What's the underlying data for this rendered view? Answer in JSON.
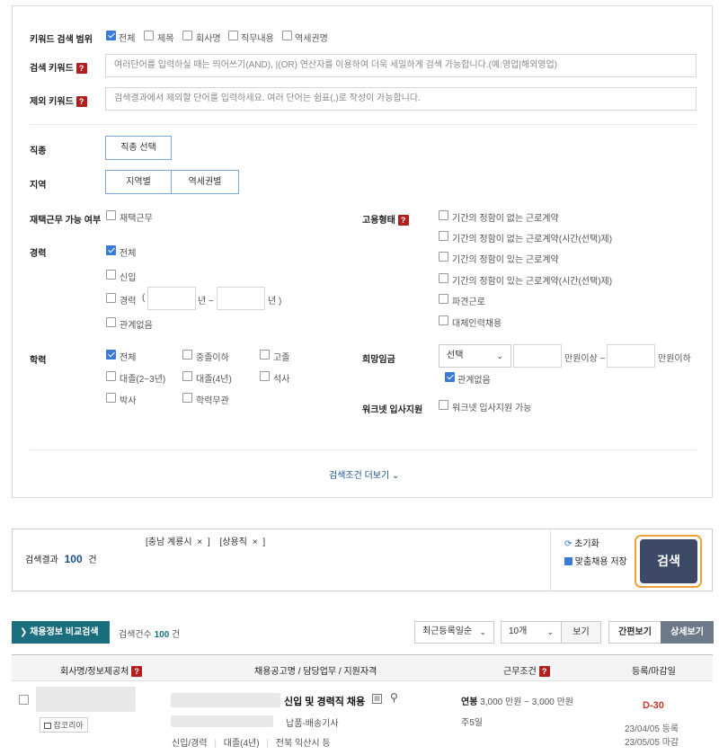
{
  "search_panel": {
    "keyword_scope_label": "키워드 검색 범위",
    "scope_options": [
      {
        "label": "전체",
        "checked": true
      },
      {
        "label": "제목",
        "checked": false
      },
      {
        "label": "회사명",
        "checked": false
      },
      {
        "label": "직무내용",
        "checked": false
      },
      {
        "label": "역세권명",
        "checked": false
      }
    ],
    "search_keyword_label": "검색 키워드",
    "search_keyword_placeholder": "여러단어를 입력하실 때는 띄어쓰기(AND), |(OR) 연산자를 이용하여 더욱 세밀하게 검색 가능합니다.(예:영업|해외영업)",
    "exclude_keyword_label": "제외 키워드",
    "exclude_keyword_placeholder": "검색결과에서 제외할 단어를 입력하세요. 여러 단어는 쉼표(,)로 작성이 가능합니다.",
    "job_type_label": "직종",
    "job_type_button": "직종 선택",
    "region_label": "지역",
    "region_button": "지역별",
    "station_button": "역세권별",
    "remote_label": "재택근무 가능 여부",
    "remote_option": "재택근무",
    "career_label": "경력",
    "career_all": "전체",
    "career_new": "신입",
    "career_exp": "경력",
    "career_paren_open": "(",
    "career_year1": "년 ~",
    "career_year2": "년 )",
    "career_any": "관계없음",
    "edu_label": "학력",
    "edu_options": [
      {
        "label": "전체",
        "checked": true
      },
      {
        "label": "중졸이하",
        "checked": false
      },
      {
        "label": "고졸",
        "checked": false
      },
      {
        "label": "대졸(2~3년)",
        "checked": false
      },
      {
        "label": "대졸(4년)",
        "checked": false
      },
      {
        "label": "석사",
        "checked": false
      },
      {
        "label": "박사",
        "checked": false
      },
      {
        "label": "학력무관",
        "checked": false
      }
    ],
    "employment_label": "고용형태",
    "employment_options": [
      "기간의 정함이 없는 근로계약",
      "기간의 정함이 없는 근로계약(시간(선택)제)",
      "기간의 정함이 있는 근로계약",
      "기간의 정함이 있는 근로계약(시간(선택)제)",
      "파견근로",
      "대체인력채용"
    ],
    "salary_label": "희망임금",
    "salary_select": "선택",
    "salary_min_suffix": "만원이상 ~",
    "salary_max_suffix": "만원이하",
    "salary_any": "관계없음",
    "worknet_label": "워크넷 입사지원",
    "worknet_option": "워크넷 입사지원 가능",
    "more_conditions": "검색조건 더보기"
  },
  "result_bar": {
    "tags": [
      "[충남 계룡시",
      "×",
      "]",
      "[상용직",
      "×",
      "]"
    ],
    "result_prefix": "검색결과",
    "result_count": "100",
    "result_suffix": "건",
    "reset": "초기화",
    "save": "맞춤채용 저장",
    "search_button": "검색"
  },
  "list_toolbar": {
    "compare_button": "채용정보 비교검색",
    "count_prefix": "검색건수",
    "count_value": "100",
    "count_suffix": "건",
    "sort_select": "최근등록일순",
    "page_size_select": "10개",
    "view_button": "보기",
    "simple_view": "간편보기",
    "detail_view": "상세보기"
  },
  "table": {
    "headers": [
      "회사명/정보제공처",
      "채용공고명 / 담당업무 / 지원자격",
      "근무조건",
      "등록/마감일"
    ],
    "rows": [
      {
        "source_badge": "잡코리아",
        "title_suffix": "신입 및 경력직 채용",
        "duty": "납품-배송기사",
        "qualifications": [
          "신입/경력",
          "대졸(4년)",
          "전북 익산시 등"
        ],
        "salary_label": "연봉",
        "salary_value": "3,000 만원 ~ 3,000 만원",
        "workdays": "주5일",
        "dday": "D-30",
        "registered": "23/04/05 등록",
        "deadline": "23/05/05 마감"
      }
    ]
  },
  "colors": {
    "accent_blue": "#1a4f8b",
    "teal": "#1b6e7e",
    "dday_red": "#c0392b",
    "search_btn": "#3c4a66",
    "search_outline": "#f0a23a",
    "help_red": "#b1201f"
  }
}
